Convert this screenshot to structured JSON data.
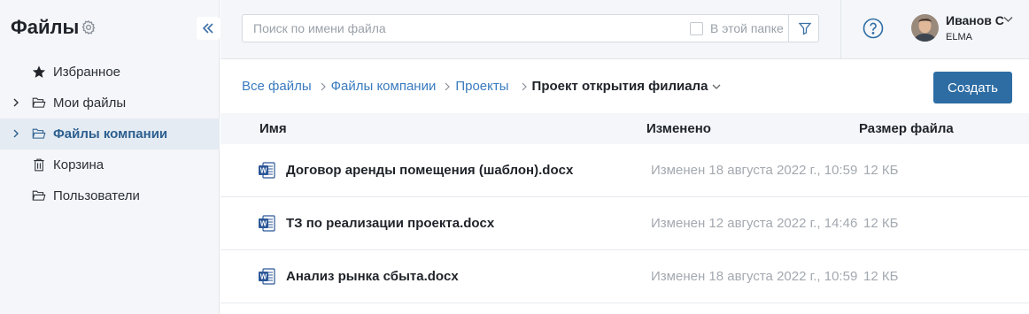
{
  "sidebar": {
    "title": "Файлы",
    "items": [
      {
        "label": "Избранное",
        "icon": "star-icon"
      },
      {
        "label": "Мои файлы",
        "icon": "folder-icon"
      },
      {
        "label": "Файлы компании",
        "icon": "folder-icon",
        "active": true
      },
      {
        "label": "Корзина",
        "icon": "trash-icon"
      },
      {
        "label": "Пользователи",
        "icon": "folder-icon"
      }
    ]
  },
  "search": {
    "placeholder": "Поиск по имени файла",
    "in_folder_label": "В этой папке"
  },
  "user": {
    "name": "Иванов С",
    "org": "ELMA"
  },
  "breadcrumbs": {
    "items": [
      "Все файлы",
      "Файлы компании",
      "Проекты"
    ],
    "current": "Проект открытия филиала"
  },
  "actions": {
    "create_label": "Создать"
  },
  "table": {
    "columns": [
      "Имя",
      "Изменено",
      "Размер файла"
    ],
    "rows": [
      {
        "name": "Договор аренды помещения (шаблон).docx",
        "modified": "Изменен 18 августа 2022 г., 10:59",
        "size": "12 КБ",
        "icon": "word-doc-icon"
      },
      {
        "name": "ТЗ по реализации проекта.docx",
        "modified": "Изменен 12 августа 2022 г., 14:46",
        "size": "12 КБ",
        "icon": "word-doc-icon"
      },
      {
        "name": "Анализ рынка сбыта.docx",
        "modified": "Изменен 18 августа 2022 г., 10:59",
        "size": "12 КБ",
        "icon": "word-doc-icon"
      }
    ]
  },
  "colors": {
    "accent": "#2e6da4",
    "link": "#3a7bbf",
    "sidebar_bg": "#f4f6f9",
    "active_bg": "#e4ebf2"
  }
}
